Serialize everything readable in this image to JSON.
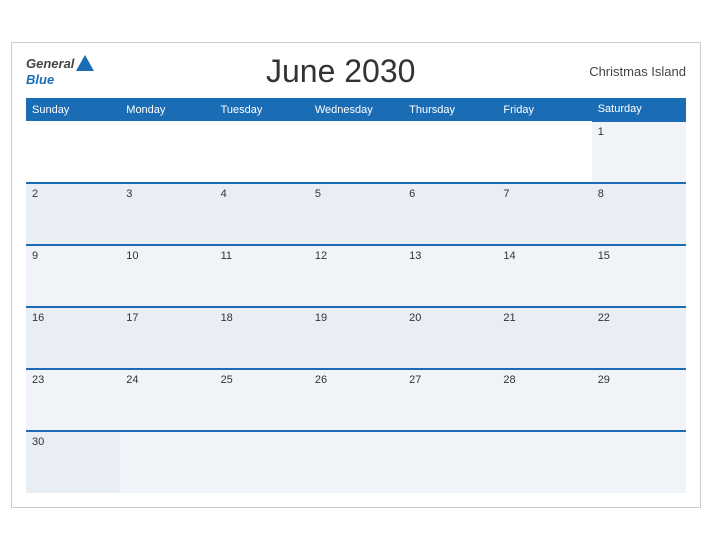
{
  "header": {
    "logo_general": "General",
    "logo_blue": "Blue",
    "title": "June 2030",
    "location": "Christmas Island"
  },
  "weekdays": [
    "Sunday",
    "Monday",
    "Tuesday",
    "Wednesday",
    "Thursday",
    "Friday",
    "Saturday"
  ],
  "weeks": [
    [
      null,
      null,
      null,
      null,
      null,
      null,
      1
    ],
    [
      2,
      3,
      4,
      5,
      6,
      7,
      8
    ],
    [
      9,
      10,
      11,
      12,
      13,
      14,
      15
    ],
    [
      16,
      17,
      18,
      19,
      20,
      21,
      22
    ],
    [
      23,
      24,
      25,
      26,
      27,
      28,
      29
    ],
    [
      30,
      null,
      null,
      null,
      null,
      null,
      null
    ]
  ]
}
